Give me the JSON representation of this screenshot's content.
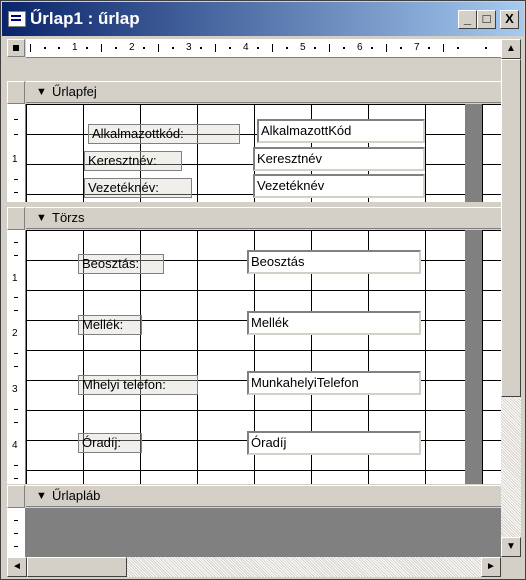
{
  "window": {
    "title": "Űrlap1 : űrlap",
    "minimize_label": "_",
    "maximize_label": "□",
    "close_label": "X"
  },
  "ruler": {
    "numbers": [
      "1",
      "2",
      "3",
      "4",
      "5",
      "6",
      "7"
    ],
    "vertical_numbers": [
      "1",
      "2",
      "3",
      "4"
    ]
  },
  "sections": {
    "header": "Űrlapfej",
    "body": "Törzs",
    "footer": "Űrlapláb"
  },
  "header_controls": [
    {
      "label": "Alkalmazottkód:",
      "field": "AlkalmazottKód"
    },
    {
      "label": "Keresztnév:",
      "field": "Keresztnév"
    },
    {
      "label": "Vezetéknév:",
      "field": "Vezetéknév"
    }
  ],
  "body_controls": [
    {
      "label": "Beosztás:",
      "field": "Beosztás"
    },
    {
      "label": "Mellék:",
      "field": "Mellék"
    },
    {
      "label": "Mhelyi telefon:",
      "field": "MunkahelyiTelefon"
    },
    {
      "label": "Óradíj:",
      "field": "Óradíj"
    }
  ],
  "scroll_arrows": {
    "up": "▲",
    "down": "▼",
    "left": "◄",
    "right": "►"
  },
  "colors": {
    "titlebar_start": "#0a246a",
    "titlebar_end": "#a6caf0",
    "face": "#d4d0c8",
    "dark": "#808080"
  }
}
